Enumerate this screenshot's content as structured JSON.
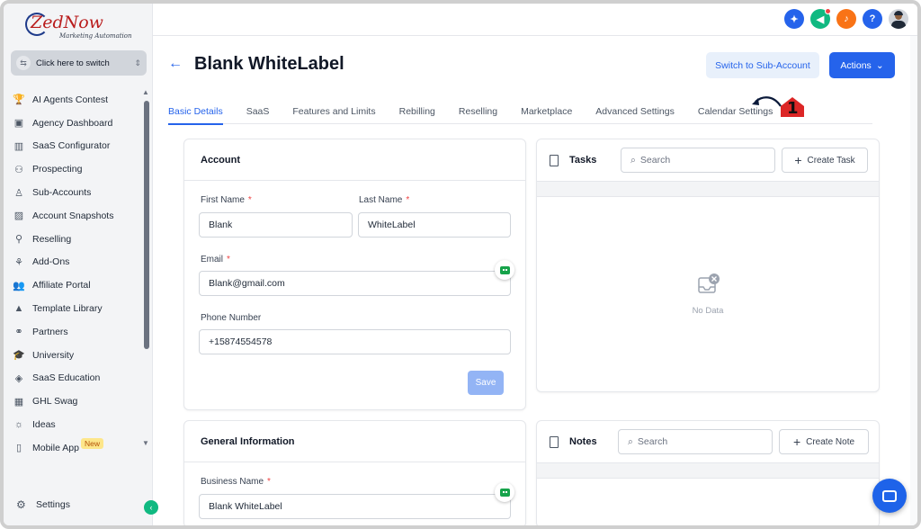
{
  "brand": {
    "logo_main": "ZedNow",
    "logo_sub": "Marketing Automation"
  },
  "switcher": {
    "label": "Click here to switch"
  },
  "sidebar": {
    "items": [
      {
        "label": "AI Agents Contest",
        "icon": "trophy-icon",
        "glyph": "🏆"
      },
      {
        "label": "Agency Dashboard",
        "icon": "dashboard-icon",
        "glyph": "▣"
      },
      {
        "label": "SaaS Configurator",
        "icon": "chart-icon",
        "glyph": "▥"
      },
      {
        "label": "Prospecting",
        "icon": "users-icon",
        "glyph": "⚇"
      },
      {
        "label": "Sub-Accounts",
        "icon": "user-icon",
        "glyph": "♙"
      },
      {
        "label": "Account Snapshots",
        "icon": "image-icon",
        "glyph": "▨"
      },
      {
        "label": "Reselling",
        "icon": "network-icon",
        "glyph": "⚲"
      },
      {
        "label": "Add-Ons",
        "icon": "puzzle-icon",
        "glyph": "⚘"
      },
      {
        "label": "Affiliate Portal",
        "icon": "group-icon",
        "glyph": "👥"
      },
      {
        "label": "Template Library",
        "icon": "shapes-icon",
        "glyph": "▲"
      },
      {
        "label": "Partners",
        "icon": "handshake-icon",
        "glyph": "⚭"
      },
      {
        "label": "University",
        "icon": "graduation-cap-icon",
        "glyph": "🎓"
      },
      {
        "label": "SaaS Education",
        "icon": "box-icon",
        "glyph": "◈"
      },
      {
        "label": "GHL Swag",
        "icon": "shirt-icon",
        "glyph": "▦"
      },
      {
        "label": "Ideas",
        "icon": "lightbulb-icon",
        "glyph": "☼"
      },
      {
        "label": "Mobile App",
        "icon": "phone-icon",
        "glyph": "▯",
        "badge": "New"
      }
    ],
    "settings_label": "Settings"
  },
  "page": {
    "title": "Blank WhiteLabel",
    "switch_button": "Switch to Sub-Account",
    "actions_button": "Actions"
  },
  "tabs": [
    "Basic Details",
    "SaaS",
    "Features and Limits",
    "Rebilling",
    "Reselling",
    "Marketplace",
    "Advanced Settings",
    "Calendar Settings"
  ],
  "annotation": {
    "number": "1"
  },
  "account": {
    "title": "Account",
    "first_name_label": "First Name",
    "first_name_value": "Blank",
    "last_name_label": "Last Name",
    "last_name_value": "WhiteLabel",
    "email_label": "Email",
    "email_value": "Blank@gmail.com",
    "phone_label": "Phone Number",
    "phone_value": "+15874554578",
    "save_label": "Save",
    "required_mark": "*"
  },
  "general": {
    "title": "General Information",
    "business_name_label": "Business Name",
    "business_name_value": "Blank WhiteLabel"
  },
  "tasks": {
    "title": "Tasks",
    "search_placeholder": "Search",
    "create_label": "Create Task",
    "empty_text": "No Data"
  },
  "notes": {
    "title": "Notes",
    "search_placeholder": "Search",
    "create_label": "Create Note"
  },
  "colors": {
    "primary": "#2563eb",
    "accent_red": "#b91c1c",
    "save_disabled": "#93b4f5"
  }
}
